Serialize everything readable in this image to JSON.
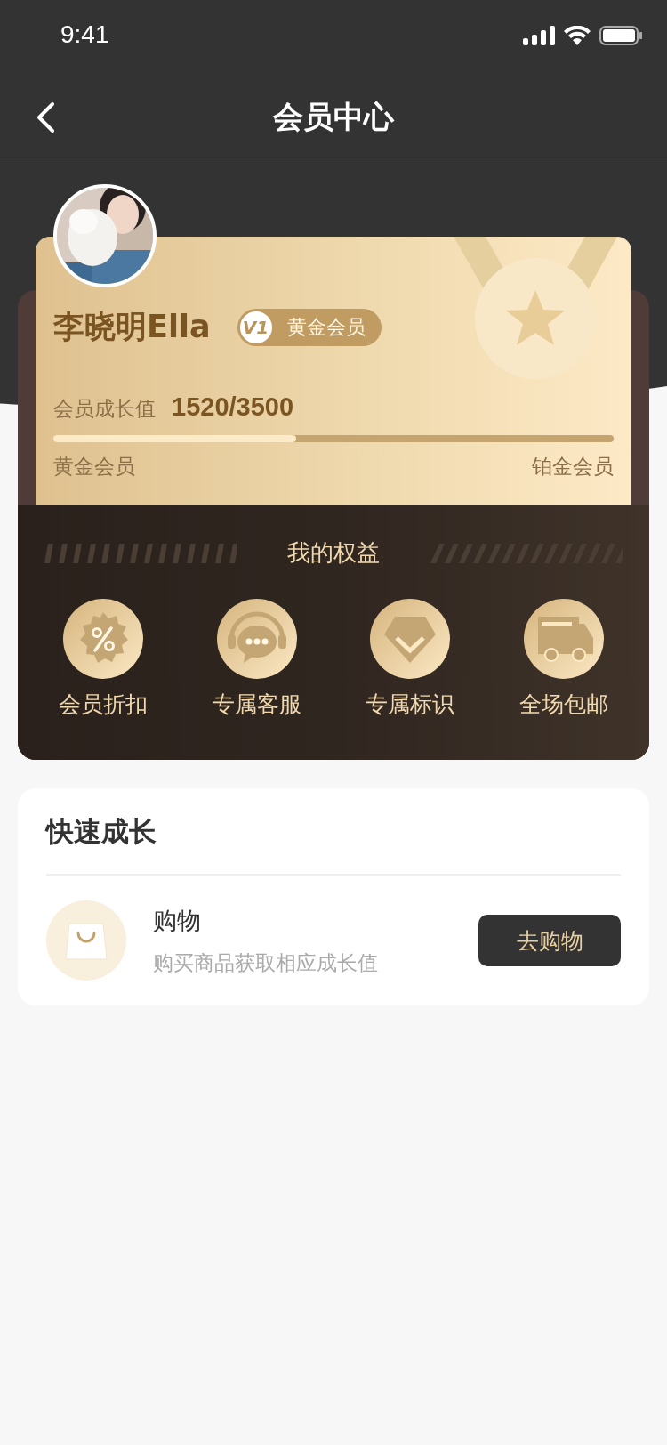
{
  "status_bar": {
    "time": "9:41"
  },
  "nav": {
    "title": "会员中心"
  },
  "member": {
    "kind": "picture",
    "name": "李晓明Ella",
    "badge_mark": "V1",
    "badge_label": "黄金会员",
    "growth_label": "会员成长值",
    "growth_value": "1520/3500",
    "level": 0.434,
    "current_level": "黄金会员",
    "next_level": "铂金会员"
  },
  "benefits": {
    "title": "我的权益",
    "items": [
      {
        "kind": "discount",
        "label": "会员折扣"
      },
      {
        "kind": "service",
        "label": "专属客服"
      },
      {
        "kind": "badge",
        "label": "专属标识"
      },
      {
        "kind": "shipping",
        "label": "全场包邮"
      }
    ]
  },
  "quick_growth": {
    "title": "快速成长",
    "tasks": [
      {
        "kind": "shopping",
        "title": "购物",
        "subtitle": "购买商品获取相应成长值",
        "button": "去购物"
      }
    ]
  }
}
